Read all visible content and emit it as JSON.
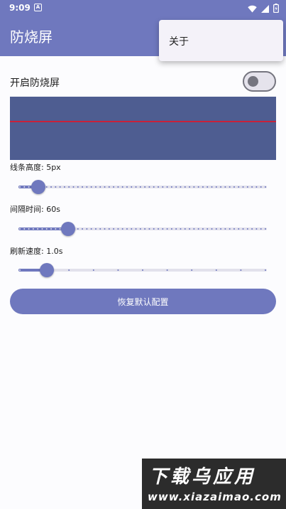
{
  "status_bar": {
    "time": "9:09",
    "notification_icon": "A"
  },
  "app_bar": {
    "title": "防烧屏"
  },
  "overflow_menu": {
    "items": [
      "关于"
    ]
  },
  "toggle": {
    "label": "开启防烧屏",
    "checked": false
  },
  "sliders": [
    {
      "label": "线条高度: 5px",
      "fraction": 0.08
    },
    {
      "label": "间隔时间: 60s",
      "fraction": 0.2
    },
    {
      "label": "刷新速度: 1.0s",
      "fraction": 0.115
    }
  ],
  "reset_button": {
    "label": "恢复默认配置"
  },
  "watermark": {
    "line1": "下载乌应用",
    "line2": "www.xiazaimao.com"
  },
  "colors": {
    "primary": "#6f78be",
    "preview_bg": "#4e5d91",
    "preview_line": "#c8213a"
  },
  "icons": [
    "wifi-icon",
    "signal-icon",
    "battery-icon"
  ]
}
